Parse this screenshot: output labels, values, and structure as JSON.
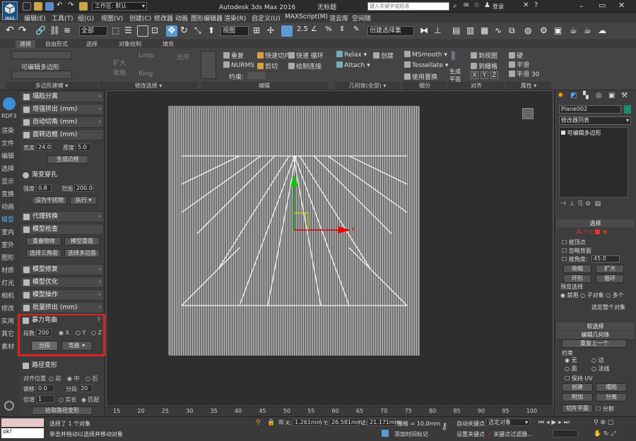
{
  "title": {
    "workspace_label": "工作区: 默认",
    "app_name": "Autodesk 3ds Max 2016",
    "doc_name": "无标题",
    "search_placeholder": "键入关键字或短语",
    "login": "登录"
  },
  "menu": [
    "编辑(E)",
    "工具(T)",
    "组(G)",
    "视图(V)",
    "创建(C)",
    "修改器",
    "动画",
    "图形编辑器",
    "渲染(R)",
    "自定义(U)",
    "MAXScript(M)",
    "渲云库",
    "空间随"
  ],
  "toolbar": {
    "filter_value": "全部",
    "view_value": "视图",
    "named_selection": "创建选择集",
    "app_icon_label": "MAX"
  },
  "ribbon_tabs": [
    "建模",
    "自由形式",
    "选择",
    "对象绘制",
    "填充"
  ],
  "ribbon": {
    "edit_poly_label": "可编辑多边形",
    "poly_modeling_footer": "多边形建模",
    "modify_sel_footer": "修改选择",
    "edit_footer": "编辑",
    "geometry_footer": "几何体(全部)",
    "subdiv_footer": "细分",
    "align_footer": "对齐",
    "props_footer": "属性",
    "loop": "Loop",
    "ring": "Ring",
    "grow": "扩大",
    "shrink": "收缩",
    "light_ring": "光环",
    "repeat": "重复",
    "quickslice": "快速切片",
    "quickloop": "快速 循环",
    "nurms": "NURMS",
    "cut": "剪切",
    "paint_connect": "绘制连接",
    "constraints": "约束:",
    "relax": "Relax",
    "create": "创建",
    "attach": "Attach",
    "msmooth": "MSmooth",
    "tessellate": "Tessellate",
    "use_displacement": "使用置换",
    "generate_plane": "生成平面",
    "to_view": "到视图",
    "to_grid": "到栅格",
    "x": "X",
    "y": "Y",
    "z": "Z",
    "hard": "硬",
    "smooth": "平滑",
    "smooth30": "平滑 30"
  },
  "left_strip": [
    "RDF3",
    "渲染",
    "文件",
    "编辑",
    "选择",
    "显示",
    "变换",
    "动画",
    "模型",
    "室内",
    "室外",
    "图形",
    "材质",
    "灯光",
    "相机",
    "修改",
    "实用",
    "其它",
    "素材"
  ],
  "panel": {
    "collapse_sep": "塌陷分离",
    "inc_extrude": "增强挤出 (mm)",
    "auto_chamfer": "自动切角 (mm)",
    "face_border": "面转边框 (mm)",
    "width_label": "宽度",
    "width_value": "24.0",
    "thick_label": "厚度",
    "thick_value": "5.0",
    "gen_border": "生成边框",
    "gradient_hole": "渐变穿孔",
    "strength_label": "强度",
    "strength_value": "0.8",
    "range_label": "范围",
    "range_value": "200.0",
    "set_disturb": "设为干扰物",
    "execute": "执行",
    "proxy": "代理转换",
    "model_check": "模型检查",
    "overlap": "重叠物体",
    "overlap_face": "模型重面",
    "select_tri": "选择三角面",
    "select_poly": "选择多边面",
    "model_repair": "模型修复",
    "model_optimize": "模型优化",
    "model_ops": "模型操作",
    "batch_extrude": "批量挤出 (mm)",
    "violent_bend": "暴力弯曲",
    "segments_label": "段数",
    "segments_value": "200",
    "axis_x": "X",
    "axis_y": "Y",
    "axis_z": "Z",
    "segment_btn": "分段",
    "bend_btn": "弯曲",
    "path_deform": "路径变形",
    "align_pos": "对齐位置",
    "front": "前",
    "middle": "中",
    "back": "后",
    "offset_label": "偏移",
    "offset_value": "0.0",
    "seg_label": "分段",
    "seg_value": "20",
    "scale_label": "倍增",
    "scale_value": "1",
    "instance": "实长",
    "match": "匹配",
    "pick_path": "拾取路径变形"
  },
  "viewport": {
    "x_axis": "x"
  },
  "timeline": {
    "ticks": [
      "15",
      "20",
      "25",
      "30",
      "35",
      "40",
      "45",
      "50",
      "55",
      "60",
      "65",
      "70",
      "75",
      "80",
      "85",
      "90",
      "95",
      "100"
    ]
  },
  "command_panel": {
    "object_name": "Plane002",
    "modifier_list": "修改器列表",
    "stack_item": "可编辑多边形",
    "selection": "选择",
    "by_vertex": "按顶点",
    "ignore_back": "忽略背面",
    "by_angle": "按角度:",
    "angle_value": "45.0",
    "shrink": "收缩",
    "grow": "扩大",
    "ring": "环形",
    "loop": "循环",
    "preview_sel": "预览选择",
    "disable": "禁用",
    "subobj": "子对象",
    "multi": "多个",
    "select_whole": "选定整个对象",
    "soft_sel": "软选择",
    "edit_geom": "编辑几何体",
    "repeat_last": "重复上一个",
    "constraints": "约束",
    "none": "无",
    "edge": "边",
    "face": "面",
    "normal": "法线",
    "keep_uv": "保持 UV",
    "create": "创建",
    "collapse": "塌陷",
    "attach": "附加",
    "detach": "分离",
    "slice_plane": "切片平面",
    "split": "分割"
  },
  "status": {
    "selected_msg": "选择了 1 个对象",
    "hint_msg": "单击并拖动以选择并移动对象",
    "x_label": "X:",
    "x_value": "1.261mm",
    "y_label": "Y:",
    "y_value": "26.581mm",
    "z_label": "Z:",
    "z_value": "21.171mm",
    "grid_label": "栅格 = 10.0mm",
    "add_time_tag": "添加时间标记",
    "auto_key": "自动关键点",
    "sel_objects": "选定对象",
    "set_key": "设置关键点",
    "key_filter": "关键点过滤器...",
    "script_value": "ok!"
  }
}
